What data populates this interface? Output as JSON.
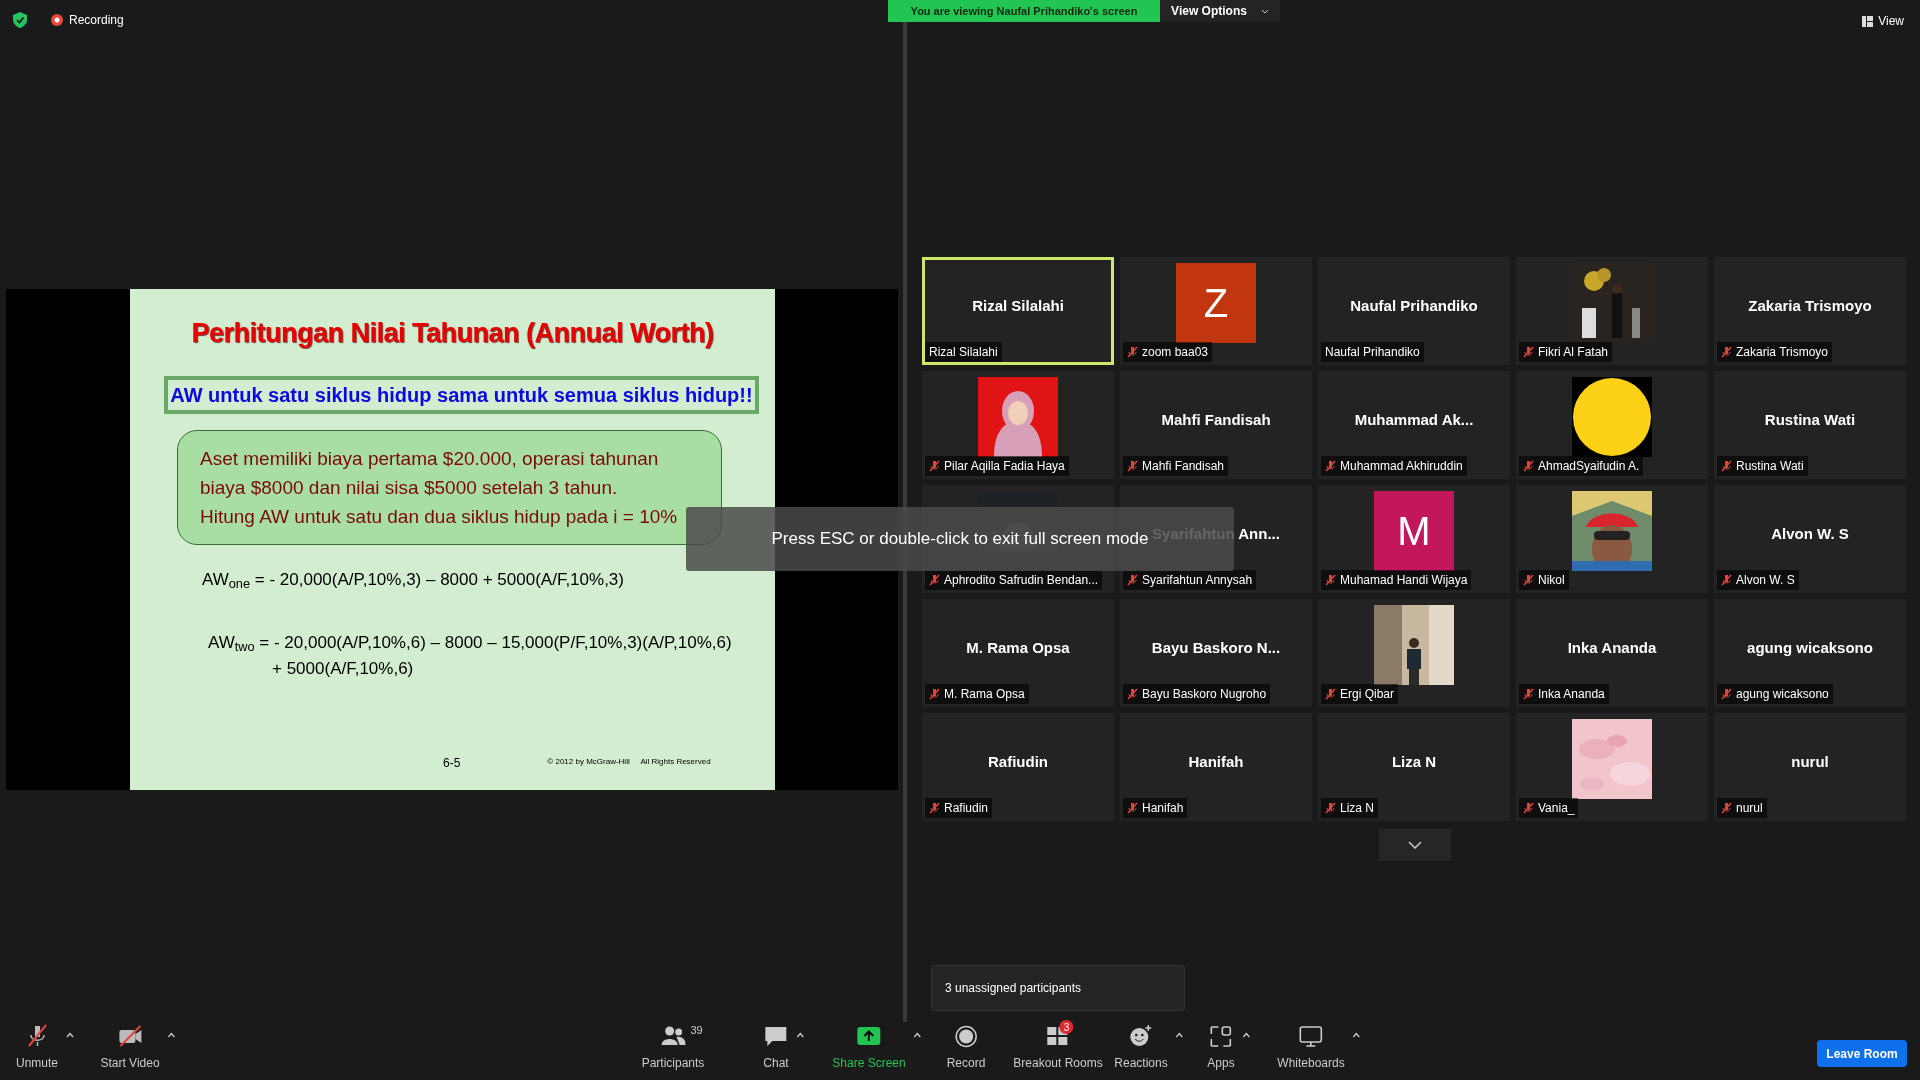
{
  "top_bar": {
    "recording": "Recording",
    "sharing_banner": "You are viewing Naufal Prihandiko's screen",
    "view_options": "View Options",
    "view": "View"
  },
  "slide": {
    "title": "Perhitungan Nilai Tahunan (Annual Worth)",
    "headline": "AW untuk satu siklus hidup sama untuk semua siklus hidup!!",
    "problem": [
      "Aset memiliki biaya pertama $20.000, operasi tahunan",
      "biaya $8000 dan nilai sisa $5000 setelah 3 tahun.",
      "Hitung AW untuk satu dan dua siklus hidup pada i = 10%"
    ],
    "equation_one": "AW$_{one}$ = - 20,000(A/P,10%,3) – 8000 + 5000(A/F,10%,3)",
    "equation_two": [
      "AW$_{two}$ = - 20,000(A/P,10%,6) – 8000 – 15,000(P/F,10%,3)(A/P,10%,6)",
      "+ 5000(A/F,10%,6)"
    ],
    "page_number": "6-5",
    "copyright": "© 2012 by McGraw-Hill     All Rights Reserved"
  },
  "fullscreen_notice": "Press ESC or double-click to exit full screen mode",
  "participants": [
    {
      "kind": "name",
      "display": "Rizal Silalahi",
      "label": "Rizal Silalahi",
      "muted": false,
      "speaking": true
    },
    {
      "kind": "letter",
      "display": "Z",
      "color": "#c1360f",
      "label": "zoom baa03",
      "muted": true,
      "speaking": false
    },
    {
      "kind": "name",
      "display": "Naufal Prihandiko",
      "label": "Naufal Prihandiko",
      "muted": false,
      "speaking": false
    },
    {
      "kind": "picture",
      "label": "Fikri Al Fatah",
      "muted": true,
      "speaking": false
    },
    {
      "kind": "name",
      "display": "Zakaria Trismoyo",
      "label": "Zakaria Trismoyo",
      "muted": true,
      "speaking": false
    },
    {
      "kind": "picture",
      "label": "Pilar Aqilla Fadia Haya",
      "muted": true,
      "speaking": false
    },
    {
      "kind": "name",
      "display": "Mahfi Fandisah",
      "label": "Mahfi Fandisah",
      "muted": true,
      "speaking": false
    },
    {
      "kind": "name",
      "display": "Muhammad Ak...",
      "label": "Muhammad Akhiruddin",
      "muted": true,
      "speaking": false
    },
    {
      "kind": "picture",
      "label": "AhmadSyaifudin A.",
      "muted": true,
      "speaking": false
    },
    {
      "kind": "name",
      "display": "Rustina Wati",
      "label": "Rustina Wati",
      "muted": true,
      "speaking": false
    },
    {
      "kind": "picture",
      "label": "Aphrodito Safrudin Bendan...",
      "muted": true,
      "speaking": false
    },
    {
      "kind": "name",
      "display": "Syarifahtun Ann...",
      "label": "Syarifahtun Annysah",
      "muted": true,
      "speaking": false
    },
    {
      "kind": "letter",
      "display": "M",
      "color": "#c2185b",
      "label": "Muhamad Handi Wijaya",
      "muted": true,
      "speaking": false
    },
    {
      "kind": "picture",
      "label": "Nikol",
      "muted": true,
      "speaking": false
    },
    {
      "kind": "name",
      "display": "Alvon W. S",
      "label": "Alvon W. S",
      "muted": true,
      "speaking": false
    },
    {
      "kind": "name",
      "display": "M. Rama Opsa",
      "label": "M. Rama Opsa",
      "muted": true,
      "speaking": false
    },
    {
      "kind": "name",
      "display": "Bayu Baskoro N...",
      "label": "Bayu Baskoro Nugroho",
      "muted": true,
      "speaking": false
    },
    {
      "kind": "picture",
      "label": "Ergi Qibar",
      "muted": true,
      "speaking": false
    },
    {
      "kind": "name",
      "display": "Inka Ananda",
      "label": "Inka Ananda",
      "muted": true,
      "speaking": false
    },
    {
      "kind": "name",
      "display": "agung wicaksono",
      "label": "agung wicaksono",
      "muted": true,
      "speaking": false
    },
    {
      "kind": "name",
      "display": "Rafiudin",
      "label": "Rafiudin",
      "muted": true,
      "speaking": false
    },
    {
      "kind": "name",
      "display": "Hanifah",
      "label": "Hanifah",
      "muted": true,
      "speaking": false
    },
    {
      "kind": "name",
      "display": "Liza N",
      "label": "Liza N",
      "muted": true,
      "speaking": false
    },
    {
      "kind": "picture",
      "label": "Vania_",
      "muted": true,
      "speaking": false
    },
    {
      "kind": "name",
      "display": "nurul",
      "label": "nurul",
      "muted": true,
      "speaking": false
    }
  ],
  "tooltip": "3 unassigned participants",
  "toolbar": {
    "left": [
      {
        "kind": "mic",
        "label": "Unmute"
      },
      {
        "kind": "video",
        "label": "Start Video"
      }
    ],
    "center": [
      {
        "kind": "participants",
        "label": "Participants",
        "count": "39",
        "caret": false
      },
      {
        "kind": "chat",
        "label": "Chat",
        "caret": true
      },
      {
        "kind": "share",
        "label": "Share Screen",
        "caret": true
      },
      {
        "kind": "record",
        "label": "Record",
        "caret": false
      },
      {
        "kind": "breakout",
        "label": "Breakout Rooms",
        "badge": "3",
        "caret": false
      },
      {
        "kind": "reactions",
        "label": "Reactions",
        "caret": true
      },
      {
        "kind": "apps",
        "label": "Apps",
        "caret": true
      },
      {
        "kind": "whiteboard",
        "label": "Whiteboards",
        "caret": true
      }
    ],
    "leave": "Leave Room"
  }
}
